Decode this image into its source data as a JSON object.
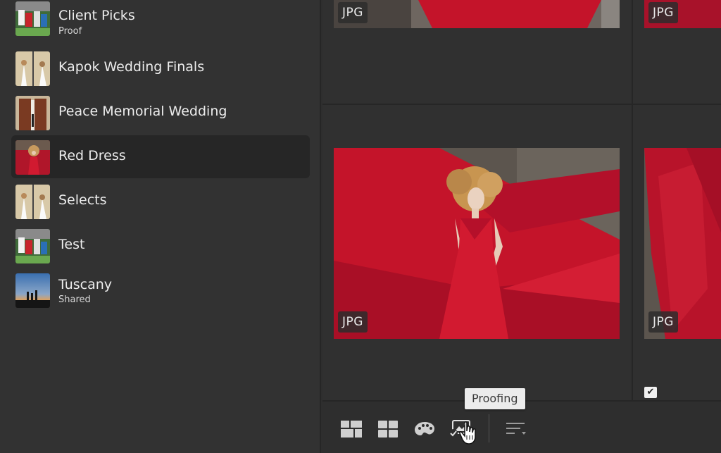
{
  "sidebar": {
    "albums": [
      {
        "name": "Client Picks",
        "sub": "Proof"
      },
      {
        "name": "Kapok Wedding Finals",
        "sub": ""
      },
      {
        "name": "Peace Memorial Wedding",
        "sub": ""
      },
      {
        "name": "Red Dress",
        "sub": ""
      },
      {
        "name": "Selects",
        "sub": ""
      },
      {
        "name": "Test",
        "sub": ""
      },
      {
        "name": "Tuscany",
        "sub": "Shared"
      }
    ],
    "selected": "Red Dress"
  },
  "grid": {
    "badges": {
      "top_left": "JPG",
      "top_right": "JPG",
      "mid_left": "JPG",
      "mid_right": "JPG"
    }
  },
  "toolbar": {
    "tooltip": "Proofing",
    "icons": [
      "mosaic-view-icon",
      "square-grid-icon",
      "palette-icon",
      "proofing-icon",
      "sort-icon"
    ]
  },
  "colors": {
    "sidebar_bg": "#323232",
    "selected_row": "#262626",
    "dress_red": "#c4142a"
  }
}
